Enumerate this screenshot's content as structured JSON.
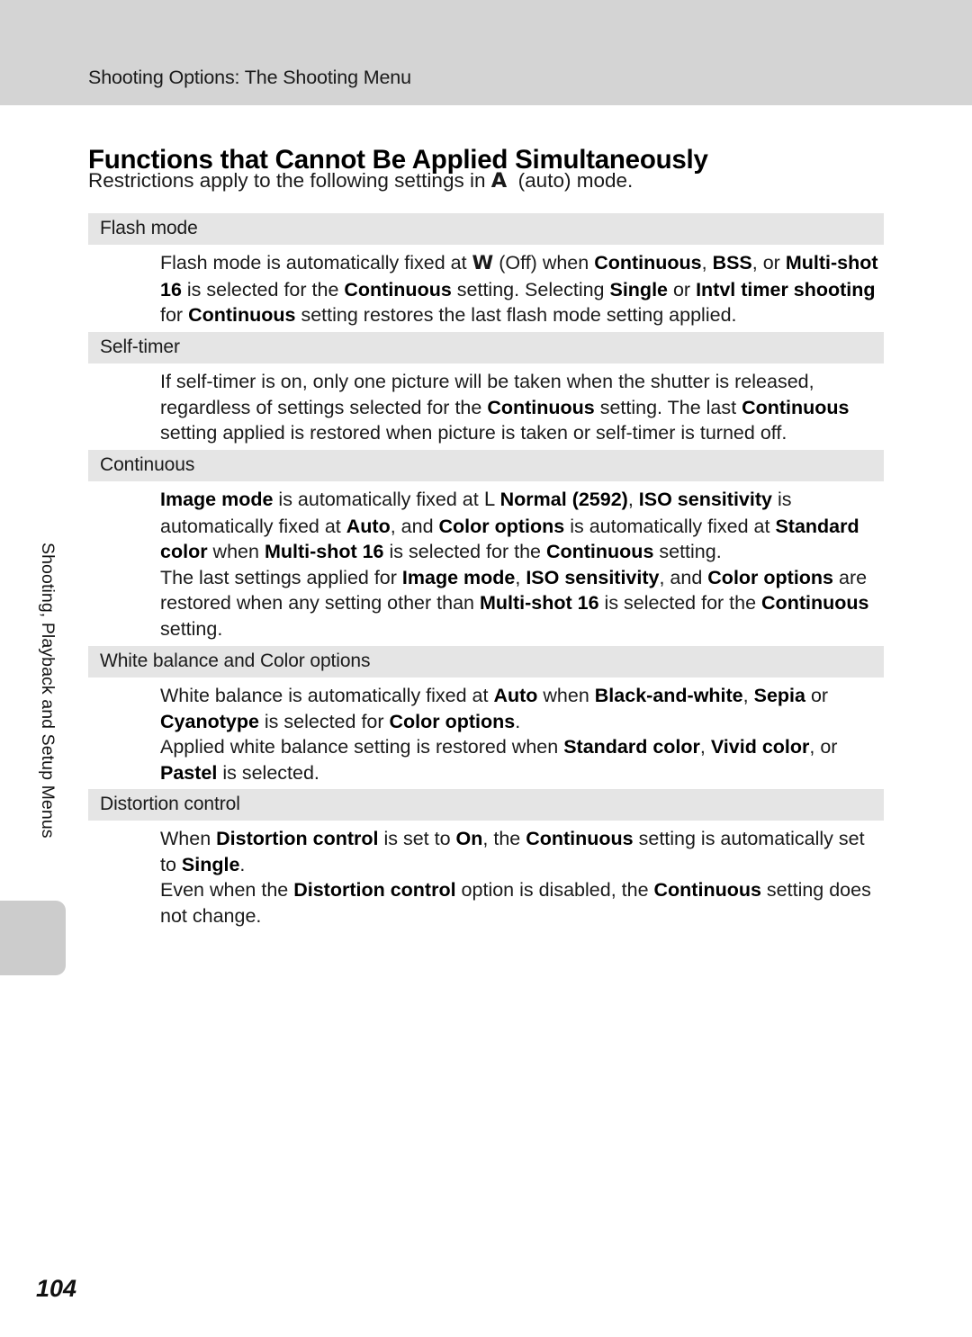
{
  "header": {
    "running_head": "Shooting Options: The Shooting Menu",
    "band_color": "#d4d4d4"
  },
  "sidebar": {
    "chapter_label": "Shooting, Playback and Setup Menus",
    "tab_color": "#cccccc"
  },
  "page": {
    "heading": "Functions that Cannot Be Applied Simultaneously",
    "intro_before_symbol": "Restrictions apply to the following settings in ",
    "intro_symbol": "A",
    "intro_after_symbol": "(auto) mode.",
    "folio": "104",
    "band_color": "#e5e5e5"
  },
  "sections": [
    {
      "title": "Flash mode",
      "paragraphs": [
        [
          {
            "t": "Flash mode is automatically fixed at ",
            "b": false
          },
          {
            "t": "W",
            "b": true,
            "sym": true
          },
          {
            "t": " (Off) when ",
            "b": false
          },
          {
            "t": "Continuous",
            "b": true
          },
          {
            "t": ", ",
            "b": false
          },
          {
            "t": "BSS",
            "b": true
          },
          {
            "t": ", or ",
            "b": false
          },
          {
            "t": "Multi-shot 16",
            "b": true
          },
          {
            "t": " is selected for the ",
            "b": false
          },
          {
            "t": "Continuous",
            "b": true
          },
          {
            "t": " setting. Selecting ",
            "b": false
          },
          {
            "t": "Single",
            "b": true
          },
          {
            "t": " or ",
            "b": false
          },
          {
            "t": "Intvl timer shooting",
            "b": true
          },
          {
            "t": " for ",
            "b": false
          },
          {
            "t": "Continuous",
            "b": true
          },
          {
            "t": " setting restores the last flash mode setting applied.",
            "b": false
          }
        ]
      ]
    },
    {
      "title": "Self-timer",
      "paragraphs": [
        [
          {
            "t": "If self-timer is on, only one picture will be taken when the shutter is released, regardless of settings selected for the ",
            "b": false
          },
          {
            "t": "Continuous",
            "b": true
          },
          {
            "t": " setting. The last ",
            "b": false
          },
          {
            "t": "Continuous",
            "b": true
          },
          {
            "t": " setting applied is restored when picture is taken or self-timer is turned off.",
            "b": false
          }
        ]
      ]
    },
    {
      "title": "Continuous",
      "paragraphs": [
        [
          {
            "t": "Image mode",
            "b": true
          },
          {
            "t": " is automatically fixed at ",
            "b": false
          },
          {
            "t": "L",
            "b": false,
            "sym": true
          },
          {
            "t": "  ",
            "b": false
          },
          {
            "t": "Normal (2592)",
            "b": true
          },
          {
            "t": ", ",
            "b": false
          },
          {
            "t": "ISO sensitivity",
            "b": true
          },
          {
            "t": " is automatically fixed at ",
            "b": false
          },
          {
            "t": "Auto",
            "b": true
          },
          {
            "t": ", and ",
            "b": false
          },
          {
            "t": "Color options",
            "b": true
          },
          {
            "t": " is automatically fixed at ",
            "b": false
          },
          {
            "t": "Standard color",
            "b": true
          },
          {
            "t": " when ",
            "b": false
          },
          {
            "t": "Multi-shot 16",
            "b": true
          },
          {
            "t": " is selected for the ",
            "b": false
          },
          {
            "t": "Continuous",
            "b": true
          },
          {
            "t": " setting.",
            "b": false
          }
        ],
        [
          {
            "t": "The last settings applied for ",
            "b": false
          },
          {
            "t": "Image mode",
            "b": true
          },
          {
            "t": ", ",
            "b": false
          },
          {
            "t": "ISO sensitivity",
            "b": true
          },
          {
            "t": ", and ",
            "b": false
          },
          {
            "t": "Color options",
            "b": true
          },
          {
            "t": " are restored when any setting other than ",
            "b": false
          },
          {
            "t": "Multi-shot 16",
            "b": true
          },
          {
            "t": " is selected for the ",
            "b": false
          },
          {
            "t": "Continuous",
            "b": true
          },
          {
            "t": " setting.",
            "b": false
          }
        ]
      ]
    },
    {
      "title": "White balance and Color options",
      "paragraphs": [
        [
          {
            "t": "White balance is automatically fixed at ",
            "b": false
          },
          {
            "t": "Auto",
            "b": true
          },
          {
            "t": " when ",
            "b": false
          },
          {
            "t": "Black-and-white",
            "b": true
          },
          {
            "t": ", ",
            "b": false
          },
          {
            "t": "Sepia",
            "b": true
          },
          {
            "t": " or ",
            "b": false
          },
          {
            "t": "Cyanotype",
            "b": true
          },
          {
            "t": " is selected for ",
            "b": false
          },
          {
            "t": "Color options",
            "b": true
          },
          {
            "t": ".",
            "b": false
          }
        ],
        [
          {
            "t": "Applied white balance setting is restored when ",
            "b": false
          },
          {
            "t": "Standard color",
            "b": true
          },
          {
            "t": ", ",
            "b": false
          },
          {
            "t": "Vivid color",
            "b": true
          },
          {
            "t": ", or ",
            "b": false
          },
          {
            "t": "Pastel",
            "b": true
          },
          {
            "t": " is selected.",
            "b": false
          }
        ]
      ]
    },
    {
      "title": "Distortion control",
      "paragraphs": [
        [
          {
            "t": "When ",
            "b": false
          },
          {
            "t": "Distortion control",
            "b": true
          },
          {
            "t": " is set to ",
            "b": false
          },
          {
            "t": "On",
            "b": true
          },
          {
            "t": ", the ",
            "b": false
          },
          {
            "t": "Continuous",
            "b": true
          },
          {
            "t": " setting is automatically set to ",
            "b": false
          },
          {
            "t": "Single",
            "b": true
          },
          {
            "t": ".",
            "b": false
          }
        ],
        [
          {
            "t": "Even when the ",
            "b": false
          },
          {
            "t": "Distortion control",
            "b": true
          },
          {
            "t": " option is disabled, the ",
            "b": false
          },
          {
            "t": "Continuous",
            "b": true
          },
          {
            "t": " setting does not change.",
            "b": false
          }
        ]
      ]
    }
  ]
}
